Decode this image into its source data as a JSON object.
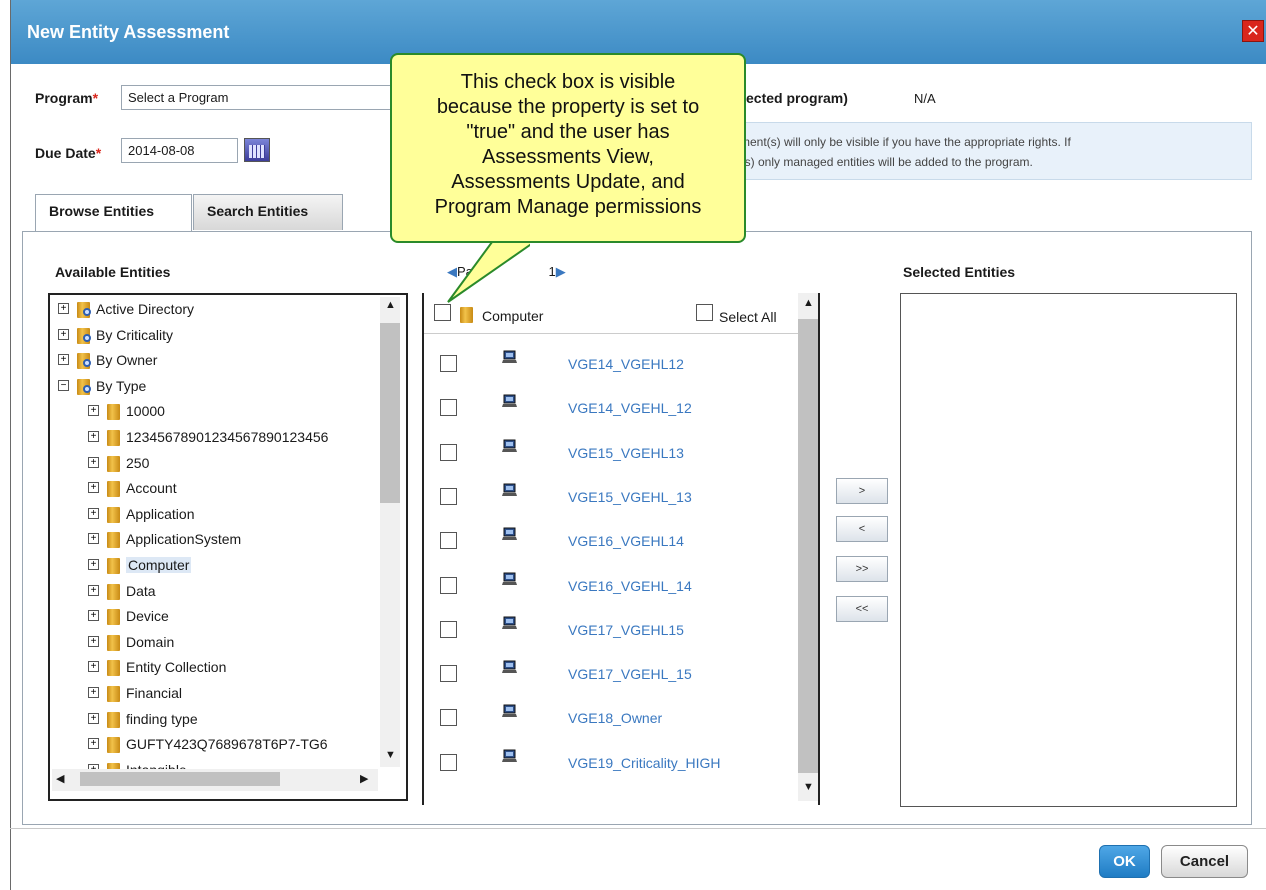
{
  "dialog": {
    "title": "New Entity Assessment",
    "close_label": "✕"
  },
  "form": {
    "program_label": "Program",
    "program_value": "Select a Program",
    "required_mark": "*",
    "selected_program_label": "ected program)",
    "selected_program_value": "N/A",
    "due_date_label": "Due Date",
    "due_date_value": "2014-08-08",
    "info_line1": "sment(s) will only be visible if you have the appropriate rights. If",
    "info_line2": "p(s) only managed entities will be added to the program."
  },
  "tabs": [
    {
      "label": "Browse Entities",
      "active": true
    },
    {
      "label": "Search Entities",
      "active": false
    }
  ],
  "available": {
    "title": "Available Entities",
    "paging": "Pa",
    "paging_suffix": "1",
    "tree": [
      {
        "label": "Active Directory",
        "level": 0,
        "expander": "+",
        "type": "search-folder"
      },
      {
        "label": "By Criticality",
        "level": 0,
        "expander": "+",
        "type": "search-folder"
      },
      {
        "label": "By Owner",
        "level": 0,
        "expander": "+",
        "type": "search-folder"
      },
      {
        "label": "By Type",
        "level": 0,
        "expander": "−",
        "type": "search-folder"
      },
      {
        "label": "10000",
        "level": 1,
        "expander": "+",
        "type": "folder"
      },
      {
        "label": "12345678901234567890123456",
        "level": 1,
        "expander": "+",
        "type": "folder"
      },
      {
        "label": "250",
        "level": 1,
        "expander": "+",
        "type": "folder"
      },
      {
        "label": "Account",
        "level": 1,
        "expander": "+",
        "type": "folder"
      },
      {
        "label": "Application",
        "level": 1,
        "expander": "+",
        "type": "folder"
      },
      {
        "label": "ApplicationSystem",
        "level": 1,
        "expander": "+",
        "type": "folder"
      },
      {
        "label": "Computer",
        "level": 1,
        "expander": "+",
        "type": "folder",
        "selected": true
      },
      {
        "label": "Data",
        "level": 1,
        "expander": "+",
        "type": "folder"
      },
      {
        "label": "Device",
        "level": 1,
        "expander": "+",
        "type": "folder"
      },
      {
        "label": "Domain",
        "level": 1,
        "expander": "+",
        "type": "folder"
      },
      {
        "label": "Entity Collection",
        "level": 1,
        "expander": "+",
        "type": "folder"
      },
      {
        "label": "Financial",
        "level": 1,
        "expander": "+",
        "type": "folder"
      },
      {
        "label": "finding type",
        "level": 1,
        "expander": "+",
        "type": "folder"
      },
      {
        "label": "GUFTY423Q7689678T6P7-TG6",
        "level": 1,
        "expander": "+",
        "type": "folder"
      },
      {
        "label": "Intangible",
        "level": 1,
        "expander": "+",
        "type": "folder"
      }
    ]
  },
  "entity_list": {
    "folder_label": "Computer",
    "select_all_label": "Select All",
    "items": [
      "VGE14_VGEHL12",
      "VGE14_VGEHL_12",
      "VGE15_VGEHL13",
      "VGE15_VGEHL_13",
      "VGE16_VGEHL14",
      "VGE16_VGEHL_14",
      "VGE17_VGEHL15",
      "VGE17_VGEHL_15",
      "VGE18_Owner",
      "VGE19_Criticality_HIGH"
    ]
  },
  "move_buttons": [
    ">",
    "<",
    ">>",
    "<<"
  ],
  "selected": {
    "title": "Selected Entities"
  },
  "footer": {
    "ok_label": "OK",
    "cancel_label": "Cancel"
  },
  "callout": {
    "lines": [
      "This check box is visible",
      "because the property is set to",
      "\"true\" and the user has",
      "Assessments View,",
      "Assessments Update, and",
      "Program Manage permissions"
    ]
  },
  "colors": {
    "titlebar": "#4a98cf",
    "link": "#3a78c0",
    "callout_bg": "#ffff99",
    "callout_border": "#2a8a2a",
    "ok_button": "#1f7cc4"
  }
}
